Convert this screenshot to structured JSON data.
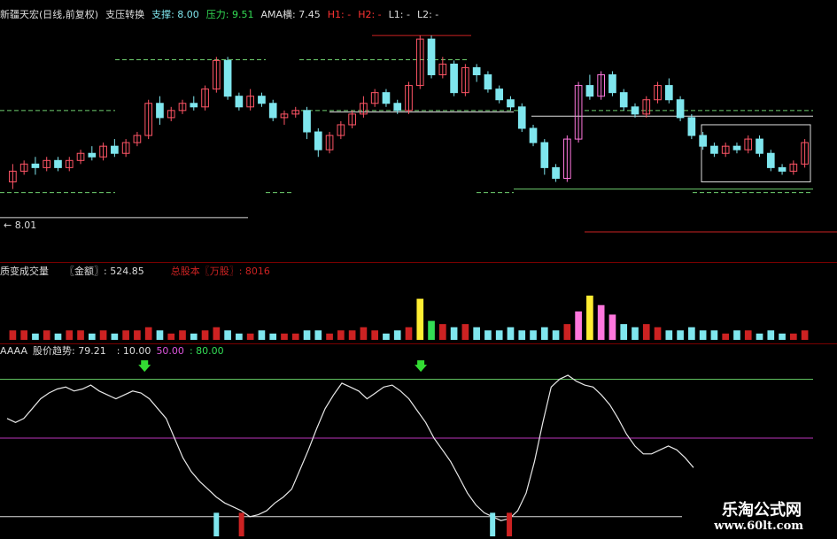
{
  "main_header": {
    "title": "新疆天宏(日线,前复权)",
    "indicator": "支压转换",
    "support_label": "支撑",
    "support_value": ": 8.00",
    "pressure_label": "压力",
    "pressure_value": ": 9.51",
    "ama_label": "AMA横",
    "ama_value": ": 7.45",
    "h1": "H1: -",
    "h2": "H2: -",
    "l1": "L1: -",
    "l2": "L2: -"
  },
  "price_marker": "← 8.01",
  "volume_header": {
    "title": "质变成交量",
    "amount_label": "〖金额〗",
    "amount_value": ": 524.85",
    "capital_label": "总股本〖万股〗",
    "capital_value": ": 8016"
  },
  "trend_header": {
    "code": "AAAA",
    "label": "股价趋势",
    "value": ": 79.21",
    "level_low": ": 10.00",
    "level_mid": "50.00",
    "level_high": ": 80.00"
  },
  "watermark": {
    "name": "乐淘公式网",
    "url": "www.60lt.com"
  },
  "colors": {
    "up_candle": "#ff5566",
    "down_candle": "#7fe6ee",
    "breakout_candle": "#ff77dd",
    "support_line": "#6fcf6f",
    "pressure_line": "#cc2222",
    "white_line": "#dddddd",
    "volume_yellow": "#ffee33",
    "volume_green": "#33dd55",
    "level_80": "#5fbf5f",
    "level_50": "#bb33bb",
    "level_10": "#dddddd",
    "arrow": "#33dd33"
  },
  "chart_data": {
    "type": "candlestick",
    "y_price_range": [
      7.1,
      10.0
    ],
    "ohlc": [
      [
        7.8,
        7.95,
        8.05,
        7.7
      ],
      [
        7.95,
        8.05,
        8.1,
        7.9
      ],
      [
        8.05,
        8.0,
        8.15,
        7.9
      ],
      [
        8.0,
        8.1,
        8.15,
        7.95
      ],
      [
        8.1,
        8.0,
        8.15,
        7.95
      ],
      [
        8.0,
        8.1,
        8.15,
        7.95
      ],
      [
        8.1,
        8.2,
        8.25,
        8.05
      ],
      [
        8.2,
        8.15,
        8.3,
        8.1
      ],
      [
        8.15,
        8.3,
        8.35,
        8.1
      ],
      [
        8.3,
        8.2,
        8.4,
        8.15
      ],
      [
        8.2,
        8.35,
        8.4,
        8.15
      ],
      [
        8.35,
        8.45,
        8.5,
        8.3
      ],
      [
        8.45,
        8.9,
        8.95,
        8.4
      ],
      [
        8.9,
        8.7,
        9.0,
        8.6
      ],
      [
        8.7,
        8.8,
        8.85,
        8.65
      ],
      [
        8.8,
        8.9,
        8.95,
        8.75
      ],
      [
        8.9,
        8.85,
        9.0,
        8.8
      ],
      [
        8.85,
        9.1,
        9.15,
        8.8
      ],
      [
        9.1,
        9.5,
        9.55,
        9.05
      ],
      [
        9.5,
        9.0,
        9.55,
        8.95
      ],
      [
        9.0,
        8.85,
        9.05,
        8.8
      ],
      [
        8.85,
        9.0,
        9.1,
        8.8
      ],
      [
        9.0,
        8.9,
        9.05,
        8.85
      ],
      [
        8.9,
        8.7,
        8.95,
        8.65
      ],
      [
        8.7,
        8.75,
        8.8,
        8.6
      ],
      [
        8.75,
        8.8,
        8.85,
        8.7
      ],
      [
        8.8,
        8.5,
        8.85,
        8.4
      ],
      [
        8.5,
        8.25,
        8.55,
        8.15
      ],
      [
        8.25,
        8.45,
        8.5,
        8.2
      ],
      [
        8.45,
        8.6,
        8.65,
        8.4
      ],
      [
        8.6,
        8.75,
        8.8,
        8.55
      ],
      [
        8.75,
        8.9,
        9.0,
        8.7
      ],
      [
        8.9,
        9.05,
        9.1,
        8.85
      ],
      [
        9.05,
        8.9,
        9.1,
        8.85
      ],
      [
        8.9,
        8.8,
        8.95,
        8.75
      ],
      [
        8.8,
        9.15,
        9.2,
        8.75
      ],
      [
        9.15,
        9.8,
        9.85,
        9.1
      ],
      [
        9.8,
        9.3,
        9.85,
        9.25
      ],
      [
        9.3,
        9.45,
        9.55,
        9.25
      ],
      [
        9.45,
        9.05,
        9.5,
        9.0
      ],
      [
        9.05,
        9.4,
        9.45,
        9.0
      ],
      [
        9.4,
        9.3,
        9.45,
        9.2
      ],
      [
        9.3,
        9.1,
        9.35,
        9.05
      ],
      [
        9.1,
        8.95,
        9.15,
        8.9
      ],
      [
        8.95,
        8.85,
        9.0,
        8.8
      ],
      [
        8.85,
        8.55,
        8.9,
        8.5
      ],
      [
        8.55,
        8.35,
        8.6,
        8.3
      ],
      [
        8.35,
        8.0,
        8.4,
        7.9
      ],
      [
        8.0,
        7.85,
        8.05,
        7.8
      ],
      [
        7.85,
        8.4,
        8.45,
        7.8
      ],
      [
        8.4,
        9.15,
        9.2,
        8.35
      ],
      [
        9.15,
        9.0,
        9.3,
        8.95
      ],
      [
        9.0,
        9.3,
        9.35,
        8.95
      ],
      [
        9.3,
        9.05,
        9.35,
        9.0
      ],
      [
        9.05,
        8.85,
        9.1,
        8.8
      ],
      [
        8.85,
        8.75,
        8.9,
        8.7
      ],
      [
        8.75,
        8.95,
        9.0,
        8.7
      ],
      [
        8.95,
        9.15,
        9.2,
        8.9
      ],
      [
        9.15,
        8.95,
        9.25,
        8.9
      ],
      [
        8.95,
        8.7,
        9.0,
        8.65
      ],
      [
        8.7,
        8.45,
        8.75,
        8.4
      ],
      [
        8.45,
        8.3,
        8.5,
        8.25
      ],
      [
        8.3,
        8.2,
        8.35,
        8.15
      ],
      [
        8.2,
        8.3,
        8.35,
        8.15
      ],
      [
        8.3,
        8.25,
        8.35,
        8.2
      ],
      [
        8.25,
        8.4,
        8.45,
        8.2
      ],
      [
        8.4,
        8.2,
        8.45,
        8.15
      ],
      [
        8.2,
        8.0,
        8.25,
        7.95
      ],
      [
        8.0,
        7.95,
        8.05,
        7.9
      ],
      [
        7.95,
        8.05,
        8.1,
        7.9
      ],
      [
        8.05,
        8.35,
        8.4,
        8.0
      ]
    ],
    "volume": [
      3,
      3,
      2,
      3,
      2,
      3,
      3,
      2,
      3,
      2,
      3,
      3,
      4,
      3,
      2,
      3,
      2,
      3,
      4,
      3,
      2,
      2,
      3,
      2,
      2,
      2,
      3,
      3,
      2,
      3,
      3,
      4,
      3,
      2,
      3,
      4,
      13,
      6,
      5,
      4,
      5,
      4,
      3,
      3,
      4,
      3,
      3,
      4,
      3,
      5,
      9,
      14,
      11,
      8,
      5,
      4,
      5,
      4,
      3,
      3,
      4,
      3,
      3,
      2,
      3,
      3,
      2,
      3,
      2,
      2,
      3
    ],
    "trend": [
      60,
      58,
      60,
      65,
      70,
      73,
      75,
      76,
      74,
      75,
      77,
      74,
      72,
      70,
      72,
      74,
      73,
      70,
      65,
      60,
      50,
      40,
      33,
      28,
      24,
      20,
      17,
      15,
      13,
      10,
      11,
      13,
      17,
      20,
      24,
      34,
      44,
      55,
      65,
      72,
      78,
      76,
      74,
      70,
      73,
      76,
      77,
      74,
      70,
      64,
      58,
      50,
      44,
      38,
      30,
      22,
      16,
      12,
      10,
      8,
      9,
      13,
      22,
      38,
      58,
      76,
      80,
      82,
      79,
      77,
      76,
      72,
      67,
      60,
      52,
      46,
      42,
      42,
      44,
      46,
      44,
      40,
      35
    ]
  }
}
